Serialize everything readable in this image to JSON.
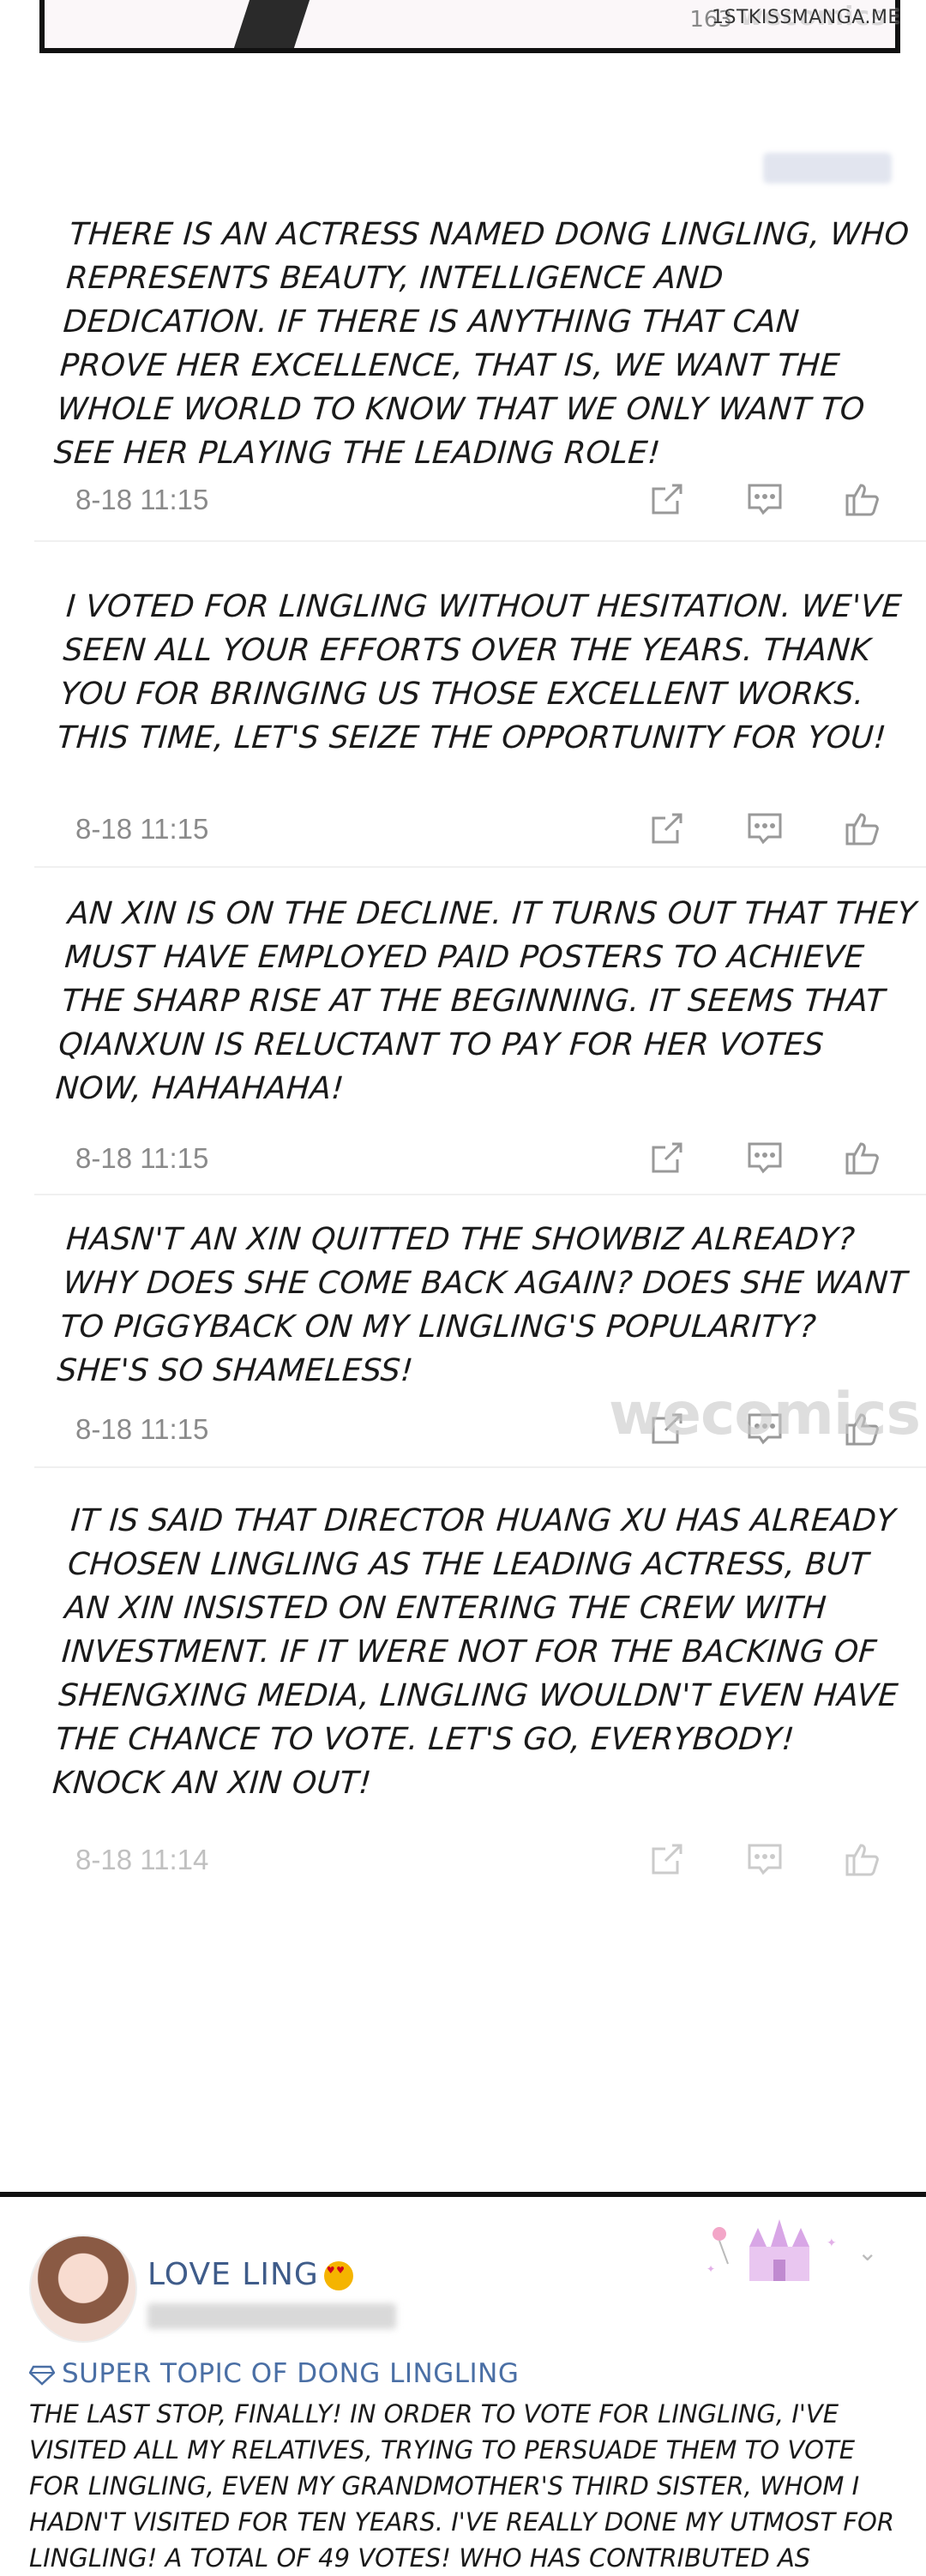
{
  "watermarks": {
    "site": "1STKISSMANGA.ME",
    "comic": "wecomics",
    "top_panel_count": "163"
  },
  "comments": [
    {
      "text": "There is an actress named Dong Lingling, who represents beauty, intelligence and dedication. If there is anything that can prove her excellence, that is, we want the whole world to know that we only want to see her playing the leading role!",
      "time": "8-18 11:15"
    },
    {
      "text": "I voted for Lingling without hesitation. We've seen all your efforts over the years. Thank you for bringing us those excellent works. This time, let's seize the opportunity for you!",
      "time": "8-18 11:15"
    },
    {
      "text": "An Xin is on the decline. It turns out that they must have employed paid posters to achieve the sharp rise at the beginning. It seems that Qianxun is reluctant to pay for her votes now, hahahaha!",
      "time": "8-18 11:15"
    },
    {
      "text": "Hasn't An Xin quitted the showbiz already? Why does she come back again? Does she want to piggyback on my Lingling's popularity? She's so shameless!",
      "time": "8-18 11:15"
    },
    {
      "text": "It is said that director Huang Xu has already chosen Lingling as the leading actress, but An Xin insisted on entering the crew with investment. If it were not for the backing of Shengxing Media, Lingling wouldn't even have the chance to vote. Let's go, everybody! Knock An Xin out!",
      "time": "8-18 11:14"
    }
  ],
  "post": {
    "username": "LOVE LING",
    "topic": "SUPER TOPIC OF DONG LINGLING",
    "text": "The last stop, finally! In order to vote for Lingling, I've visited all my relatives, trying to persuade them to vote for Lingling, even my grandmother's third sister, whom I hadn't visited for ten years. I've really done my utmost for Lingling! A total of 49 votes! Who has contributed as"
  },
  "icons": {
    "share": "share-icon",
    "reply": "comment-icon",
    "like": "thumbs-up-icon"
  },
  "colors": {
    "timestamp": "#8a8a8a",
    "username": "#3f5c8a",
    "topic": "#4a6fa5"
  }
}
